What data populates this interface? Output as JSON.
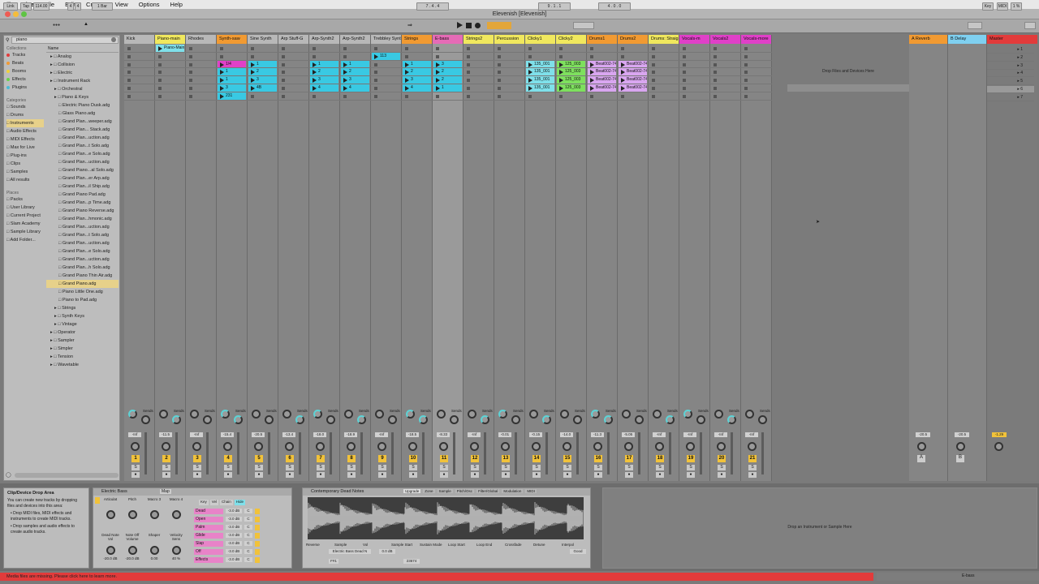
{
  "menubar": {
    "apple": "",
    "items": [
      "Live",
      "File",
      "Edit",
      "Create",
      "View",
      "Options",
      "Help"
    ]
  },
  "window": {
    "title": "Elevenish  [Elevenish]"
  },
  "transport": {
    "link": "Link",
    "tap": "Tap",
    "tempo": "114.00",
    "sig_num": "4",
    "sig_den": "4",
    "quant": "1 Bar",
    "arr_pos": "7 . 4 . 4",
    "loop_start": "9 . 1 . 1",
    "loop_len": "4 . 0 . 0",
    "key": "Key",
    "midi": "MIDI",
    "cpu": "1 %"
  },
  "browser": {
    "search_value": "piano",
    "collections_header": "Collections",
    "collections": [
      {
        "label": "Tracks",
        "color": "#e23b3b"
      },
      {
        "label": "Beats",
        "color": "#f19a32"
      },
      {
        "label": "Booms",
        "color": "#f1d23a"
      },
      {
        "label": "Effects",
        "color": "#68d34b"
      },
      {
        "label": "Plugins",
        "color": "#4bbad3"
      }
    ],
    "categories_header": "Categories",
    "categories": [
      "Sounds",
      "Drums",
      "Instruments",
      "Audio Effects",
      "MIDI Effects",
      "Max for Live",
      "Plug-ins",
      "Clips",
      "Samples",
      "All results"
    ],
    "selected_category": "Instruments",
    "places_header": "Places",
    "places": [
      "Packs",
      "User Library",
      "Current Project",
      "Slam Academy",
      "Sample Library",
      "Add Folder..."
    ],
    "name_header": "Name",
    "files": [
      {
        "label": "Analog",
        "indent": 1
      },
      {
        "label": "Collision",
        "indent": 1
      },
      {
        "label": "Electric",
        "indent": 1
      },
      {
        "label": "Instrument Rack",
        "indent": 1
      },
      {
        "label": "Orchestral",
        "indent": 2
      },
      {
        "label": "Piano & Keys",
        "indent": 2
      },
      {
        "label": "Electric Piano Dusk.adg",
        "indent": 3
      },
      {
        "label": "Glass Piano.adg",
        "indent": 3
      },
      {
        "label": "Grand Plan...weeper.adg",
        "indent": 3
      },
      {
        "label": "Grand Plan... Stack.adg",
        "indent": 3
      },
      {
        "label": "Grand Plan...uction.adg",
        "indent": 3
      },
      {
        "label": "Grand Plan...t Solo.adg",
        "indent": 3
      },
      {
        "label": "Grand Plan...e Solo.adg",
        "indent": 3
      },
      {
        "label": "Grand Plan...uction.adg",
        "indent": 3
      },
      {
        "label": "Grand Piano...al Solo.adg",
        "indent": 3
      },
      {
        "label": "Grand Plan...er Arp.adg",
        "indent": 3
      },
      {
        "label": "Grand Plan...il Ship.adg",
        "indent": 3
      },
      {
        "label": "Grand Piano Pad.adg",
        "indent": 3
      },
      {
        "label": "Grand Plan...p Time.adg",
        "indent": 3
      },
      {
        "label": "Grand Piano Reverse.adg",
        "indent": 3
      },
      {
        "label": "Grand Plan...hmonic.adg",
        "indent": 3
      },
      {
        "label": "Grand Plan...uction.adg",
        "indent": 3
      },
      {
        "label": "Grand Plan...t Solo.adg",
        "indent": 3
      },
      {
        "label": "Grand Plan...uction.adg",
        "indent": 3
      },
      {
        "label": "Grand Plan...e Solo.adg",
        "indent": 3
      },
      {
        "label": "Grand Plan...uction.adg",
        "indent": 3
      },
      {
        "label": "Grand Plan...h Solo.adg",
        "indent": 3
      },
      {
        "label": "Grand Piano Thin Air.adg",
        "indent": 3
      },
      {
        "label": "Grand Piano.adg",
        "indent": 3,
        "selected": true
      },
      {
        "label": "Piano Little One.adg",
        "indent": 3
      },
      {
        "label": "Piano to Pad.adg",
        "indent": 3
      },
      {
        "label": "Strings",
        "indent": 2
      },
      {
        "label": "Synth Keys",
        "indent": 2
      },
      {
        "label": "Vintage",
        "indent": 2
      },
      {
        "label": "Operator",
        "indent": 1
      },
      {
        "label": "Sampler",
        "indent": 1
      },
      {
        "label": "Simpler",
        "indent": 1
      },
      {
        "label": "Tension",
        "indent": 1
      },
      {
        "label": "Wavetable",
        "indent": 1
      }
    ]
  },
  "tracks": [
    {
      "name": "Kick",
      "color": "#b8b8b8",
      "num": "1",
      "vol": "-Inf",
      "clips": []
    },
    {
      "name": "Piano-main",
      "color": "#f0e85e",
      "num": "2",
      "vol": "-11.5",
      "clips": [
        {
          "row": 0,
          "label": "Piano-Main",
          "color": "#7fe0ea"
        }
      ]
    },
    {
      "name": "Rhodes",
      "color": "#b8b8b8",
      "num": "3",
      "vol": "-Inf",
      "clips": []
    },
    {
      "name": "Synth-saw",
      "color": "#f19a32",
      "num": "4",
      "vol": "-15.4",
      "clips": [
        {
          "row": 2,
          "label": "1/4",
          "color": "#e040c8"
        },
        {
          "row": 3,
          "label": "1",
          "color": "#39c9e3"
        },
        {
          "row": 4,
          "label": "1",
          "color": "#39c9e3"
        },
        {
          "row": 5,
          "label": "3",
          "color": "#39c9e3"
        },
        {
          "row": 6,
          "label": "231",
          "color": "#39c9e3"
        }
      ]
    },
    {
      "name": "Sine Synth",
      "color": "#b8b8b8",
      "num": "5",
      "vol": "-20.5",
      "clips": [
        {
          "row": 2,
          "label": "1",
          "color": "#39c9e3"
        },
        {
          "row": 3,
          "label": "2",
          "color": "#39c9e3"
        },
        {
          "row": 4,
          "label": "3",
          "color": "#39c9e3"
        },
        {
          "row": 5,
          "label": "4B",
          "color": "#39c9e3"
        }
      ]
    },
    {
      "name": "Arp Stuff-G",
      "color": "#b8b8b8",
      "num": "6",
      "vol": "-13.4",
      "clips": []
    },
    {
      "name": "Arp-Synth2",
      "color": "#b8b8b8",
      "num": "7",
      "vol": "-18.0",
      "clips": [
        {
          "row": 2,
          "label": "1",
          "color": "#39c9e3"
        },
        {
          "row": 3,
          "label": "2",
          "color": "#39c9e3"
        },
        {
          "row": 4,
          "label": "3",
          "color": "#39c9e3"
        },
        {
          "row": 5,
          "label": "4",
          "color": "#39c9e3"
        }
      ]
    },
    {
      "name": "Arp-Synth2",
      "color": "#b8b8b8",
      "num": "8",
      "vol": "-18.9",
      "clips": [
        {
          "row": 2,
          "label": "1",
          "color": "#39c9e3"
        },
        {
          "row": 3,
          "label": "2",
          "color": "#39c9e3"
        },
        {
          "row": 4,
          "label": "3",
          "color": "#39c9e3"
        },
        {
          "row": 5,
          "label": "4",
          "color": "#39c9e3"
        }
      ]
    },
    {
      "name": "Trebbley Synth",
      "color": "#b8b8b8",
      "num": "9",
      "vol": "-Inf",
      "clips": [
        {
          "row": 1,
          "label": "113",
          "color": "#39c9e3"
        }
      ]
    },
    {
      "name": "Strings",
      "color": "#f19a32",
      "num": "10",
      "vol": "-18.5",
      "clips": [
        {
          "row": 2,
          "label": "1",
          "color": "#39c9e3"
        },
        {
          "row": 3,
          "label": "2",
          "color": "#39c9e3"
        },
        {
          "row": 4,
          "label": "3",
          "color": "#39c9e3"
        },
        {
          "row": 5,
          "label": "4",
          "color": "#39c9e3"
        }
      ]
    },
    {
      "name": "E-bass",
      "color": "#e56bb6",
      "num": "11",
      "vol": "-8.33",
      "clips": [
        {
          "row": 2,
          "label": "3",
          "color": "#39c9e3"
        },
        {
          "row": 3,
          "label": "2",
          "color": "#39c9e3"
        },
        {
          "row": 4,
          "label": "2",
          "color": "#39c9e3"
        },
        {
          "row": 5,
          "label": "1",
          "color": "#39c9e3"
        }
      ]
    },
    {
      "name": "Strings2",
      "color": "#f0e85e",
      "num": "12",
      "vol": "-Inf",
      "clips": []
    },
    {
      "name": "Percussion",
      "color": "#f0e85e",
      "num": "13",
      "vol": "-0.01",
      "clips": []
    },
    {
      "name": "Clicky1",
      "color": "#f0e85e",
      "num": "14",
      "vol": "-0.15",
      "clips": [
        {
          "row": 2,
          "label": "135_001",
          "color": "#7fe0ea"
        },
        {
          "row": 3,
          "label": "135_001",
          "color": "#7fe0ea"
        },
        {
          "row": 4,
          "label": "135_001",
          "color": "#7fe0ea"
        },
        {
          "row": 5,
          "label": "135_001",
          "color": "#7fe0ea"
        }
      ]
    },
    {
      "name": "Clicky2",
      "color": "#f0e85e",
      "num": "15",
      "vol": "-14.0",
      "clips": [
        {
          "row": 2,
          "label": "125_003",
          "color": "#7ee05e"
        },
        {
          "row": 3,
          "label": "125_003",
          "color": "#7ee05e"
        },
        {
          "row": 4,
          "label": "125_003",
          "color": "#7ee05e"
        },
        {
          "row": 5,
          "label": "125_003",
          "color": "#7ee05e"
        }
      ]
    },
    {
      "name": "Drums1",
      "color": "#f19a32",
      "num": "16",
      "vol": "-11.3",
      "clips": [
        {
          "row": 2,
          "label": "Beat002-74",
          "color": "#d9a6f0"
        },
        {
          "row": 3,
          "label": "Beat002-74",
          "color": "#d9a6f0"
        },
        {
          "row": 4,
          "label": "Beat002-74",
          "color": "#d9a6f0"
        },
        {
          "row": 5,
          "label": "Beat002-74",
          "color": "#d9a6f0"
        }
      ]
    },
    {
      "name": "Drums2",
      "color": "#f19a32",
      "num": "17",
      "vol": "-5.05",
      "clips": [
        {
          "row": 2,
          "label": "Beat002-74",
          "color": "#d9a6f0"
        },
        {
          "row": 3,
          "label": "Beat002-74",
          "color": "#d9a6f0"
        },
        {
          "row": 4,
          "label": "Beat002-74",
          "color": "#d9a6f0"
        },
        {
          "row": 5,
          "label": "Beat002-74",
          "color": "#d9a6f0"
        }
      ]
    },
    {
      "name": "Drums: Straig",
      "color": "#f0e85e",
      "num": "18",
      "vol": "-Inf",
      "clips": []
    },
    {
      "name": "Vocals-m",
      "color": "#e040c8",
      "num": "19",
      "vol": "-Inf",
      "clips": []
    },
    {
      "name": "Vocals2",
      "color": "#e040c8",
      "num": "20",
      "vol": "-Inf",
      "clips": []
    },
    {
      "name": "Vocals-more",
      "color": "#e040c8",
      "num": "21",
      "vol": "-Inf",
      "clips": []
    }
  ],
  "drop_hint": "Drop Files and Devices Here",
  "returns": [
    {
      "name": "A Reverb",
      "color": "#f19a32",
      "letter": "A",
      "vol": "-20.5"
    },
    {
      "name": "B Delay",
      "color": "#7fd0f0",
      "letter": "B",
      "vol": "-20.5"
    }
  ],
  "master": {
    "name": "Master",
    "color": "#e23b3b",
    "vol": "-1.29",
    "scenes": [
      "1",
      "2",
      "3",
      "4",
      "5",
      "6",
      "7"
    ]
  },
  "info": {
    "title": "Clip/Device Drop Area",
    "body": "You can create new tracks by dropping files and devices into this area:",
    "bullets": [
      "Drop MIDI files, MIDI effects and instruments to create MIDI tracks.",
      "Drop samples and audio effects to create audio tracks."
    ]
  },
  "rack": {
    "name": "Electric Bass",
    "map": "Map",
    "macros": [
      "Articulat",
      "Pitch",
      "Macro 3",
      "Macro 4",
      "Dead Note Vol",
      "Note Off Volume",
      "Shaper",
      "Velocity Sens"
    ],
    "macro_vals": [
      "-20.0 dB",
      "-20.0 dB",
      "0.00",
      "40 %"
    ],
    "chain_tabs": [
      "Key",
      "Vel",
      "Chain",
      "Hide"
    ],
    "chains": [
      "Dead",
      "Open",
      "Palm",
      "Glide",
      "Slap",
      "Off",
      "Effects"
    ],
    "chain_vol": "-3.0 dB"
  },
  "sampler": {
    "name": "Contemporary Dead Notes",
    "tabs": [
      "Upgrade",
      "Zone",
      "Sample",
      "Pitch/Osc",
      "Filter/Global",
      "Modulation",
      "MIDI"
    ],
    "sample_name": "Electric Bass Dead N",
    "params": [
      "Reverse",
      "Sample",
      "Vol",
      "Sample Start",
      "Sustain Mode",
      "Loop Start",
      "Loop End",
      "Crossfade",
      "Detune",
      "Interpol"
    ],
    "vol": "0.0 dB",
    "sample_end": "23674",
    "root": "F#1",
    "interpol": "Good"
  },
  "instrument_drop": "Drop an Instrument or Sample Here",
  "status_message": "Media files are missing. Please click here to learn more.",
  "status_track": "E-bass"
}
